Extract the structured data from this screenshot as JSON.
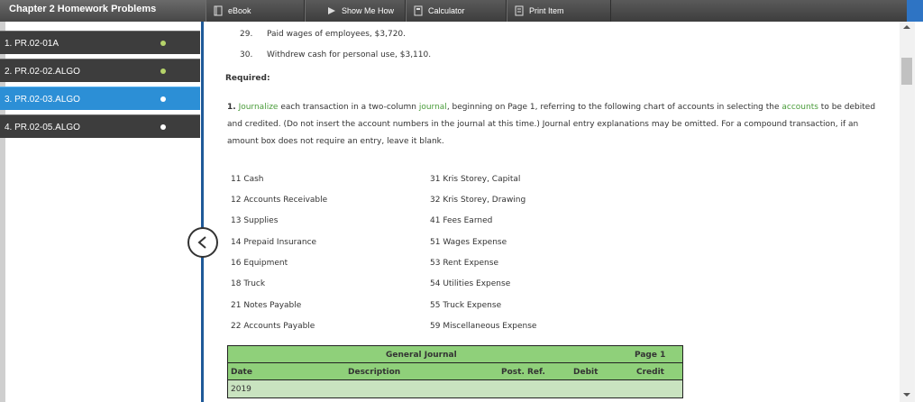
{
  "header": {
    "chapter_title": "Chapter 2 Homework Problems",
    "tools": [
      {
        "label": "eBook",
        "icon": "book-icon"
      },
      {
        "label": "Show Me How",
        "icon": "play-icon"
      },
      {
        "label": "Calculator",
        "icon": "calculator-icon"
      },
      {
        "label": "Print Item",
        "icon": "print-icon"
      }
    ]
  },
  "sidebar": {
    "items": [
      {
        "label": "1. PR.02-01A",
        "status": "green"
      },
      {
        "label": "2. PR.02-02.ALGO",
        "status": "green"
      },
      {
        "label": "3. PR.02-03.ALGO",
        "status": "white",
        "active": true
      },
      {
        "label": "4. PR.02-05.ALGO",
        "status": "white"
      }
    ]
  },
  "content": {
    "transactions": [
      {
        "num": "29.",
        "text": "Paid wages of employees, $3,720."
      },
      {
        "num": "30.",
        "text": "Withdrew cash for personal use, $3,110."
      }
    ],
    "required_label": "Required:",
    "instruction": {
      "num": "1.",
      "link1": "Journalize",
      "t1": " each transaction in a two-column ",
      "link2": "journal",
      "t2": ", beginning on Page 1, referring to the following chart of accounts in selecting the ",
      "link3": "accounts",
      "t3": " to be debited and credited. (Do not insert the account numbers in the journal at this time.) Journal entry explanations may be omitted. For a compound transaction, if an amount box does not require an entry, leave it blank."
    },
    "accounts_left": [
      "11 Cash",
      "12 Accounts Receivable",
      "13 Supplies",
      "14 Prepaid Insurance",
      "16 Equipment",
      "18 Truck",
      "21 Notes Payable",
      "22 Accounts Payable"
    ],
    "accounts_right": [
      "31 Kris Storey, Capital",
      "32 Kris Storey, Drawing",
      "41 Fees Earned",
      "51 Wages Expense",
      "53 Rent Expense",
      "54 Utilities Expense",
      "55 Truck Expense",
      "59 Miscellaneous Expense"
    ],
    "journal": {
      "title": "General Journal",
      "page": "Page 1",
      "columns": {
        "date": "Date",
        "description": "Description",
        "post_ref": "Post. Ref.",
        "debit": "Debit",
        "credit": "Credit"
      },
      "first_row_year": "2019"
    }
  },
  "colors": {
    "accent": "#2c8fd6",
    "link": "#4a9c3a",
    "table_header": "#8fd07a",
    "table_row": "#c9e3c0"
  }
}
